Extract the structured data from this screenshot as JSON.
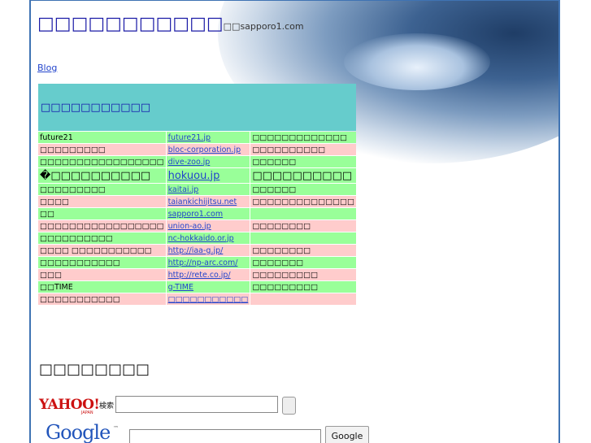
{
  "header": {
    "title": "□□□□□□□□□□□",
    "subtitle": "□□sapporo1.com"
  },
  "nav": {
    "blog_label": "Blog"
  },
  "links_table": {
    "heading": "□□□□□□□□□□□",
    "rows": [
      {
        "name": "future21",
        "link": "future21.jp",
        "desc": "□□□□□□□□□□□□□",
        "color": "g"
      },
      {
        "name": "□□□□□□□□□",
        "link": "bloc-corporation.jp",
        "desc": "□□□□□□□□□□",
        "color": "p"
      },
      {
        "name": "□□□□□□□□□□□□□□□□□",
        "link": "dive-zoo.jp",
        "desc": "□□□□□□",
        "color": "g"
      },
      {
        "name": "�□□□□□□□□□□",
        "link": "hokuou.jp",
        "desc": "□□□□□□□□□□",
        "color": "g"
      },
      {
        "name": "□□□□□□□□□",
        "link": "kaitai.jp",
        "desc": "□□□□□□",
        "color": "g"
      },
      {
        "name": "□□□□",
        "link": "taiankichijitsu.net",
        "desc": "□□□□□□□□□□□□□□",
        "color": "p"
      },
      {
        "name": "□□",
        "link": "sapporo1.com",
        "desc": "",
        "color": "g"
      },
      {
        "name": "□□□□□□□□□□□□□□□□□",
        "link": "union-ao.jp",
        "desc": "□□□□□□□□",
        "color": "p"
      },
      {
        "name": "□□□□□□□□□□",
        "link": "nc-hokkaido.or.jp",
        "desc": "",
        "color": "g"
      },
      {
        "name": "□□□□ □□□□□□□□□□□",
        "link": "http://iaa-g.jp/",
        "desc": "□□□□□□□□",
        "color": "p"
      },
      {
        "name": "□□□□□□□□□□□",
        "link": "http://np-arc.com/",
        "desc": "□□□□□□□",
        "color": "g"
      },
      {
        "name": "□□□",
        "link": "http://rete.co.jp/",
        "desc": "□□□□□□□□□",
        "color": "p"
      },
      {
        "name": "□□TIME",
        "link": "g-TIME",
        "desc": "□□□□□□□□□",
        "color": "g"
      },
      {
        "name": "□□□□□□□□□□□",
        "link": "□□□□□□□□□□□",
        "desc": "",
        "color": "p"
      }
    ]
  },
  "search": {
    "title": "□□□□□□□□",
    "yahoo": {
      "logo": "YAHOO!",
      "logo_sub": "JAPAN",
      "label": "検索",
      "value": ""
    },
    "google": {
      "logo": "Google",
      "tm": "™",
      "value": "",
      "button": "Google"
    }
  }
}
